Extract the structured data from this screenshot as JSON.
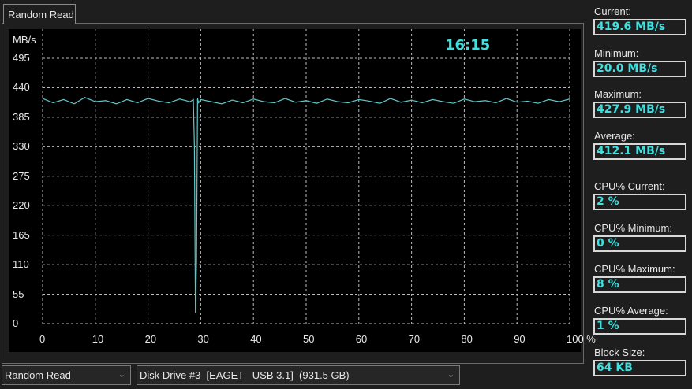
{
  "tab": {
    "label": "Random Read"
  },
  "time": "16:15",
  "stats": [
    {
      "label": "Current:",
      "value": "419.6 MB/s"
    },
    {
      "label": "Minimum:",
      "value": "20.0 MB/s"
    },
    {
      "label": "Maximum:",
      "value": "427.9 MB/s"
    },
    {
      "label": "Average:",
      "value": "412.1 MB/s"
    },
    {
      "label": "CPU% Current:",
      "value": "2 %"
    },
    {
      "label": "CPU% Minimum:",
      "value": "0 %"
    },
    {
      "label": "CPU% Maximum:",
      "value": "8 %"
    },
    {
      "label": "CPU% Average:",
      "value": "1 %"
    },
    {
      "label": "Block Size:",
      "value": "64 KB"
    }
  ],
  "controls": {
    "test_select": "Random Read",
    "drive_select": "Disk Drive #3  [EAGET   USB 3.1]  (931.5 GB)"
  },
  "chart_data": {
    "type": "line",
    "ylabel": "MB/s",
    "yticks": [
      "0",
      "55",
      "110",
      "165",
      "220",
      "275",
      "330",
      "385",
      "440",
      "495"
    ],
    "xticks": [
      "0",
      "10",
      "20",
      "30",
      "40",
      "50",
      "60",
      "70",
      "80",
      "90",
      "100 %"
    ],
    "ylim": [
      0,
      495
    ],
    "xlim": [
      0,
      100
    ],
    "grid": true,
    "line_color": "#5fc8c8",
    "x": [
      0,
      2,
      4,
      6,
      8,
      10,
      12,
      14,
      16,
      18,
      20,
      22,
      24,
      26,
      28,
      28.6,
      28.8,
      29,
      29.2,
      29.4,
      29.6,
      30,
      32,
      34,
      36,
      38,
      40,
      42,
      44,
      46,
      48,
      50,
      52,
      54,
      56,
      58,
      60,
      62,
      64,
      66,
      68,
      70,
      72,
      74,
      76,
      78,
      80,
      82,
      84,
      86,
      88,
      90,
      92,
      94,
      96,
      98,
      100
    ],
    "y": [
      420,
      412,
      418,
      410,
      422,
      414,
      416,
      410,
      418,
      412,
      420,
      415,
      412,
      419,
      414,
      418,
      330,
      20,
      115,
      420,
      412,
      418,
      414,
      410,
      417,
      412,
      419,
      414,
      412,
      420,
      413,
      416,
      411,
      419,
      414,
      412,
      418,
      415,
      411,
      420,
      413,
      417,
      412,
      418,
      414,
      411,
      419,
      414,
      416,
      412,
      420,
      413,
      415,
      411,
      418,
      414,
      419
    ]
  }
}
